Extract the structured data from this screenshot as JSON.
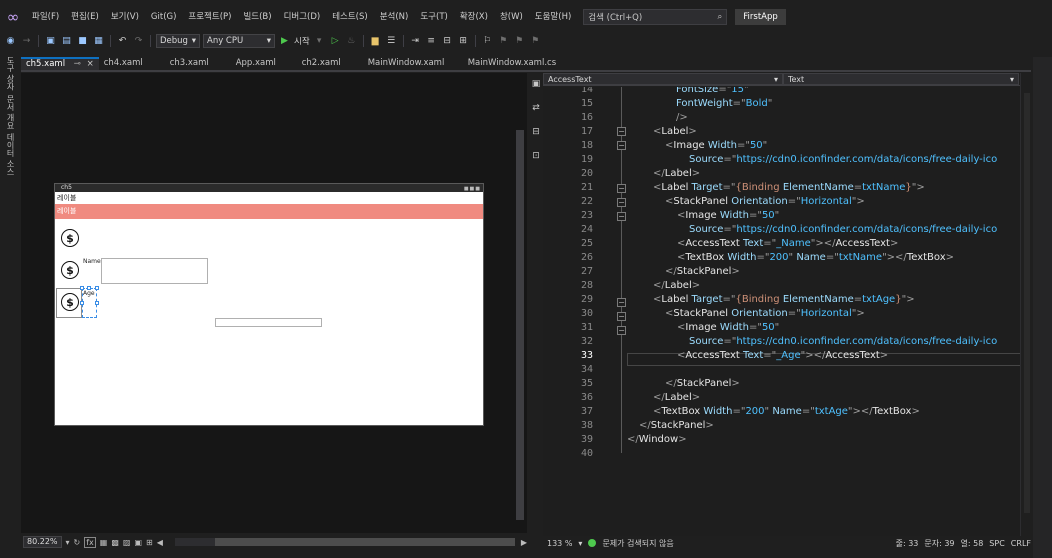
{
  "menubar": {
    "items": [
      "파일(F)",
      "편집(E)",
      "보기(V)",
      "Git(G)",
      "프로젝트(P)",
      "빌드(B)",
      "디버그(D)",
      "테스트(S)",
      "분석(N)",
      "도구(T)",
      "확장(X)",
      "창(W)",
      "도움말(H)"
    ],
    "search_placeholder": "검색 (Ctrl+Q)",
    "app_name": "FirstApp"
  },
  "toolbar": {
    "config": "Debug",
    "platform": "Any CPU",
    "start_label": "시작"
  },
  "left_strip": {
    "labels": [
      "도구 상자",
      "문서 개요",
      "데이터 소스"
    ]
  },
  "tabs": [
    {
      "label": "ch5.xaml",
      "active": true
    },
    {
      "label": "ch4.xaml"
    },
    {
      "label": "ch3.xaml"
    },
    {
      "label": "App.xaml"
    },
    {
      "label": "ch2.xaml"
    },
    {
      "label": "MainWindow.xaml"
    },
    {
      "label": "MainWindow.xaml.cs"
    }
  ],
  "designer": {
    "window_title": "ch5",
    "label_a": "레이블",
    "label_b": "레이블",
    "name_text": "Name",
    "age_text": "Age",
    "zoom": "80.22%"
  },
  "code_header": {
    "element_dropdown": "AccessText",
    "property_dropdown": "Text"
  },
  "editor": {
    "current_line": 33,
    "line_numbers": [
      14,
      15,
      16,
      17,
      18,
      19,
      20,
      21,
      22,
      23,
      24,
      25,
      26,
      27,
      28,
      29,
      30,
      31,
      32,
      33,
      34,
      35,
      36,
      37,
      38,
      39,
      40
    ]
  },
  "code_status": {
    "zoom": "133 %",
    "issues": "문제가 검색되지 않음",
    "line": "줄: 33",
    "char": "문자: 39",
    "col": "열: 58",
    "spc": "SPC",
    "crlf": "CRLF"
  },
  "colors": {
    "accent": "#0e70c0",
    "label_highlight": "#f08a80",
    "change_bar": "#4ec94e",
    "xaml_element": "#4fc1ff",
    "xaml_attribute": "#9cdcfe"
  }
}
